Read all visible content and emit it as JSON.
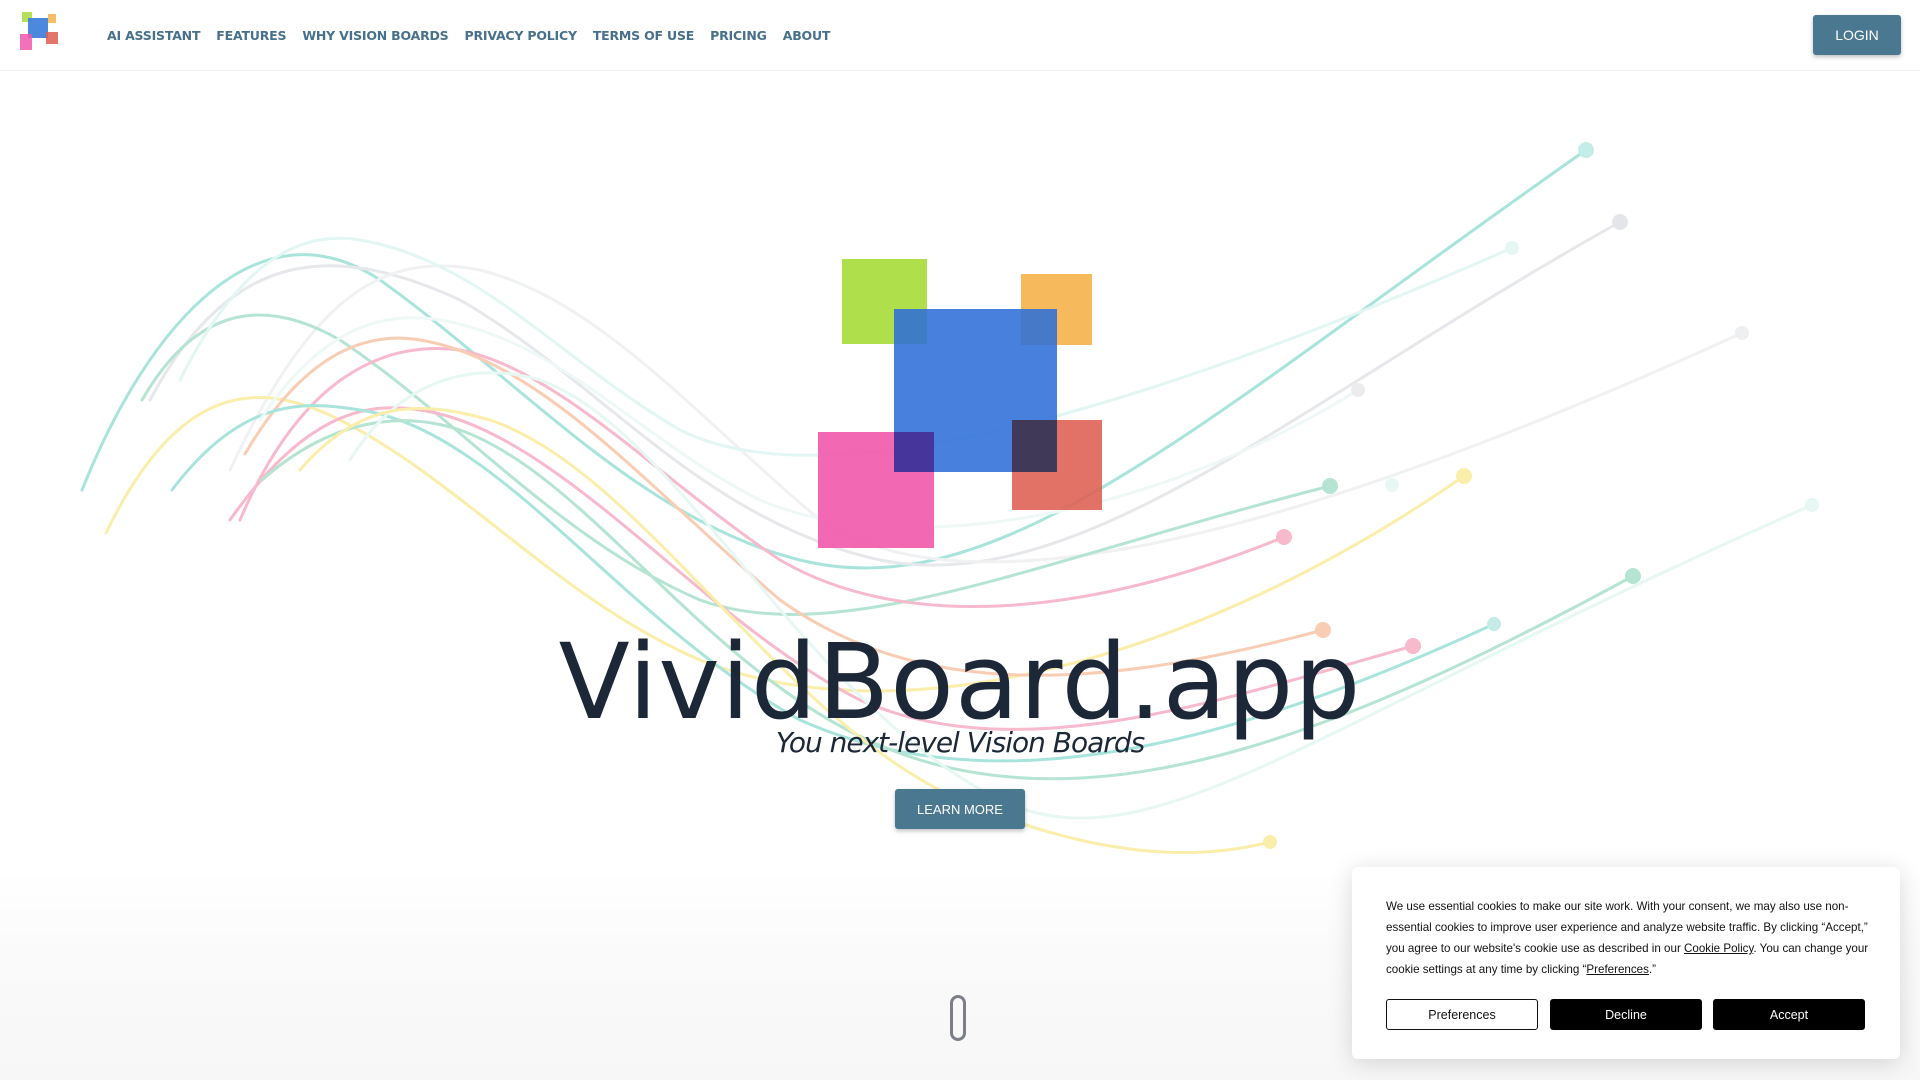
{
  "header": {
    "logo_alt": "VividBoard.app logo",
    "nav": [
      {
        "label": "AI ASSISTANT"
      },
      {
        "label": "FEATURES"
      },
      {
        "label": "WHY VISION BOARDS"
      },
      {
        "label": "PRIVACY POLICY"
      },
      {
        "label": "TERMS OF USE"
      },
      {
        "label": "PRICING"
      },
      {
        "label": "ABOUT"
      }
    ],
    "login_label": "LOGIN"
  },
  "hero": {
    "title": "VividBoard.app",
    "subtitle": "You next-level Vision Boards",
    "cta_label": "LEARN MORE",
    "logo_colors": {
      "green": "#a8dc3c",
      "orange": "#f5b34a",
      "blue": "#3a7bdc",
      "pink": "#f257ab",
      "red": "#de5e50"
    },
    "wave_colors": [
      "#a8e4dc",
      "#e3e5e8",
      "#b6e4d2",
      "#f7b9cc",
      "#fbeeaa",
      "#f9cdb4",
      "#d8f3f0"
    ]
  },
  "scroll_indicator": {
    "icon": "mouse-scroll-icon"
  },
  "cookie_banner": {
    "text_1": "We use essential cookies to make our site work. With your consent, we may also use non-essential cookies to improve user experience and analyze website traffic. By clicking “Accept,” you agree to our website's cookie use as described in our ",
    "cookie_policy_link": "Cookie Policy",
    "text_2": ". You can change your cookie settings at any time by clicking “",
    "preferences_link": "Preferences",
    "text_3": ".”",
    "buttons": {
      "preferences": "Preferences",
      "decline": "Decline",
      "accept": "Accept"
    }
  }
}
